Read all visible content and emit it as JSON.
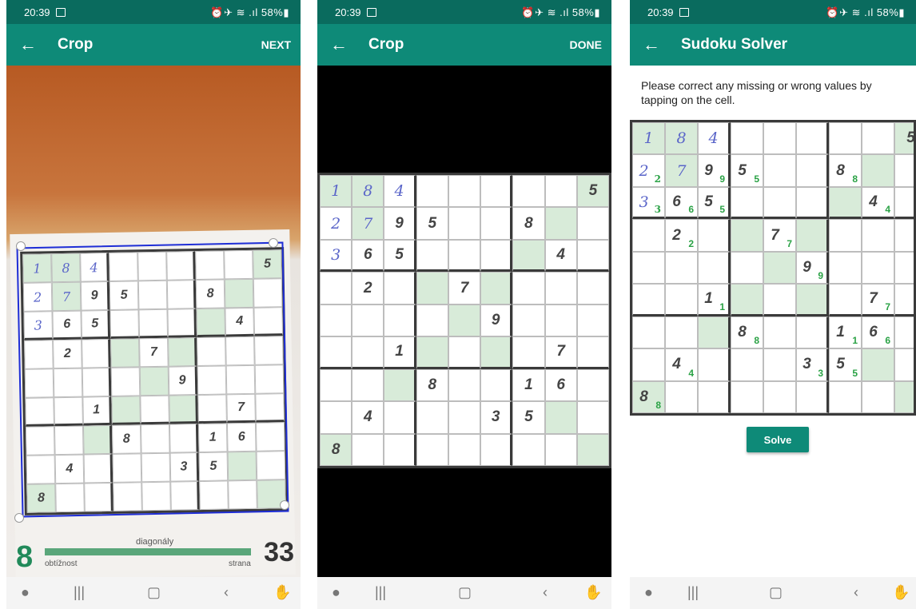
{
  "status": {
    "time": "20:39",
    "icons": "⏰✈︎ ≋ .ıl 58%▮"
  },
  "screens": [
    {
      "title": "Crop",
      "action": "NEXT"
    },
    {
      "title": "Crop",
      "action": "DONE"
    },
    {
      "title": "Sudoku Solver",
      "action": ""
    }
  ],
  "back_label": "←",
  "nav": {
    "recent": "|||",
    "home": "▢",
    "back": "‹"
  },
  "instruction": "Please correct any missing or wrong values by tapping on the cell.",
  "solve_label": "Solve",
  "footer": {
    "difficulty": "8",
    "diagonaly": "diagonály",
    "obtiznost": "obtížnost",
    "strana": "strana",
    "page_number": "33"
  },
  "puzzle_rows": [
    [
      "1",
      "8",
      "4",
      "",
      "",
      "",
      "",
      "",
      "5"
    ],
    [
      "2",
      "7",
      "9",
      "5",
      "",
      "",
      "8",
      "",
      ""
    ],
    [
      "3",
      "6",
      "5",
      "",
      "",
      "",
      "",
      "4",
      ""
    ],
    [
      "",
      "2",
      "",
      "",
      "7",
      "",
      "",
      "",
      ""
    ],
    [
      "",
      "",
      "",
      "",
      "",
      "9",
      "",
      "",
      ""
    ],
    [
      "",
      "",
      "1",
      "",
      "",
      "",
      "",
      "7",
      ""
    ],
    [
      "",
      "",
      "",
      "8",
      "",
      "",
      "1",
      "6",
      ""
    ],
    [
      "",
      "4",
      "",
      "",
      "",
      "3",
      "5",
      "",
      ""
    ],
    [
      "8",
      "",
      "",
      "",
      "",
      "",
      "",
      "",
      ""
    ]
  ],
  "recognized_rows": [
    [
      "",
      "",
      "",
      "",
      "",
      "",
      "",
      "",
      "5"
    ],
    [
      "2",
      "",
      "9",
      "5",
      "",
      "",
      "8",
      "",
      ""
    ],
    [
      "3",
      "6",
      "5",
      "",
      "",
      "",
      "",
      "4",
      ""
    ],
    [
      "",
      "2",
      "",
      "",
      "7",
      "",
      "",
      "",
      ""
    ],
    [
      "",
      "",
      "",
      "",
      "",
      "9",
      "",
      "",
      ""
    ],
    [
      "",
      "",
      "1",
      "",
      "",
      "",
      "",
      "7",
      ""
    ],
    [
      "",
      "",
      "",
      "8",
      "",
      "",
      "1",
      "6",
      ""
    ],
    [
      "",
      "4",
      "",
      "",
      "",
      "3",
      "5",
      "",
      ""
    ],
    [
      "8",
      "",
      "",
      "",
      "",
      "",
      "",
      "",
      ""
    ]
  ],
  "colors": {
    "primary": "#0e8a78",
    "status": "#0a6b5e",
    "highlight": "#d8ebd9",
    "recognized": "#2aa245",
    "handwritten": "#5b66c9"
  }
}
